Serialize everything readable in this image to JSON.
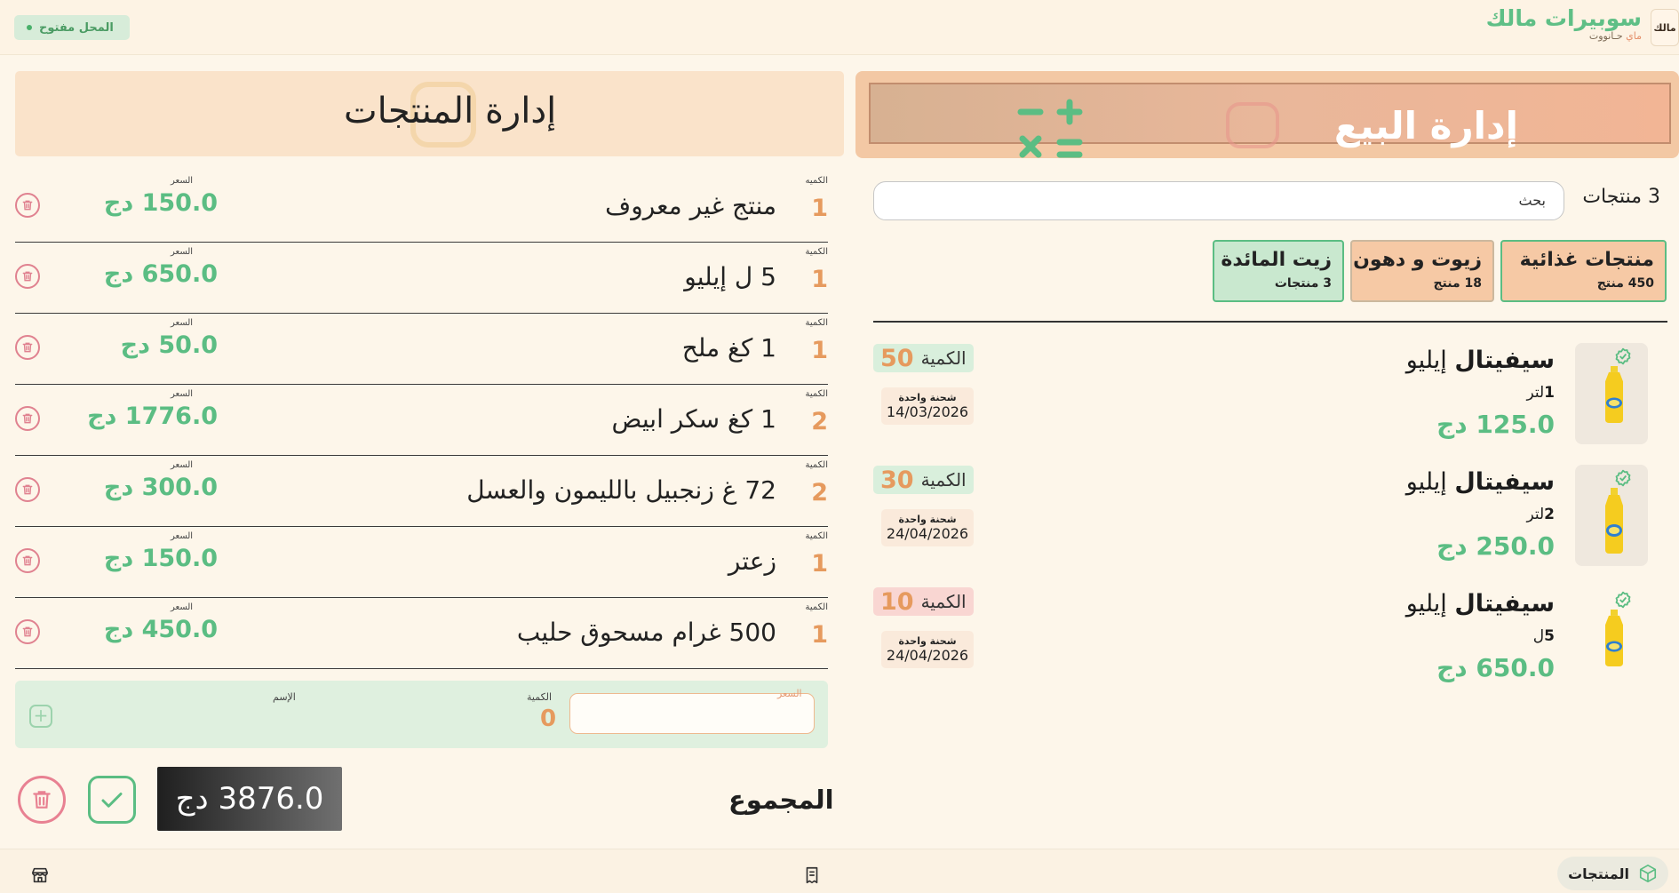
{
  "header": {
    "store_status": "المحل مفتوح",
    "brand_name": "سوبيرات مالك",
    "brand_sub_prefix": "ماي ",
    "brand_sub_highlight": "حـانووت",
    "logo_text": "مالك"
  },
  "products_panel": {
    "title": "إدارة المنتجات",
    "price_label": "السعر",
    "qty_label": "الكمية",
    "qty_label_first": "الكميه",
    "rows": [
      {
        "qty": "1",
        "name": "منتج غير معروف",
        "price": "150.0 دج"
      },
      {
        "qty": "1",
        "name": "5 ل إيليو",
        "price": "650.0 دج"
      },
      {
        "qty": "1",
        "name": "1 كغ ملح",
        "price": "50.0 دج"
      },
      {
        "qty": "2",
        "name": "1 كغ سكر ابيض",
        "price": "1776.0 دج"
      },
      {
        "qty": "2",
        "name": "72 غ زنجبيل بالليمون والعسل",
        "price": "300.0 دج"
      },
      {
        "qty": "1",
        "name": "زعتر",
        "price": "150.0 دج"
      },
      {
        "qty": "1",
        "name": "500 غرام مسحوق حليب",
        "price": "450.0 دج"
      }
    ],
    "add_row": {
      "name_label": "الإسم",
      "qty_label": "الكمية",
      "qty_value": "0",
      "price_placeholder": "السعر"
    },
    "total_label": "المجموع",
    "total_value": "3876.0 دج"
  },
  "sales_panel": {
    "title": "إدارة البيع",
    "product_count": "3 منتجات",
    "search_placeholder": "بحث",
    "categories": [
      {
        "title": "منتجات غذائية",
        "count": "450 منتج"
      },
      {
        "title": "زيوت و دهون",
        "count": "18 منتج"
      },
      {
        "title": "زيت المائدة",
        "count": "3 منتجات"
      }
    ],
    "qty_label": "الكمية",
    "shipment_label": "شحنة واحدة",
    "items": [
      {
        "brand": "سيفيتال",
        "name": "إيليو",
        "size_num": "1",
        "size_unit": "لتر",
        "price": "125.0 دج",
        "qty": "50",
        "qty_bg": "#d9efdc",
        "date": "14/03/2026"
      },
      {
        "brand": "سيفيتال",
        "name": "إيليو",
        "size_num": "2",
        "size_unit": "لتر",
        "price": "250.0 دج",
        "qty": "30",
        "qty_bg": "#d9efdc",
        "date": "24/04/2026"
      },
      {
        "brand": "سيفيتال",
        "name": "إيليو",
        "size_num": "5",
        "size_unit": "ل",
        "price": "650.0 دج",
        "qty": "10",
        "qty_bg": "#f9d6d2",
        "date": "24/04/2026"
      }
    ]
  },
  "bottom_nav": {
    "products_label": "المنتجات"
  },
  "colors": {
    "accent_green": "#5bbd83",
    "accent_orange": "#e69a5e",
    "danger_pink": "#e88192"
  }
}
